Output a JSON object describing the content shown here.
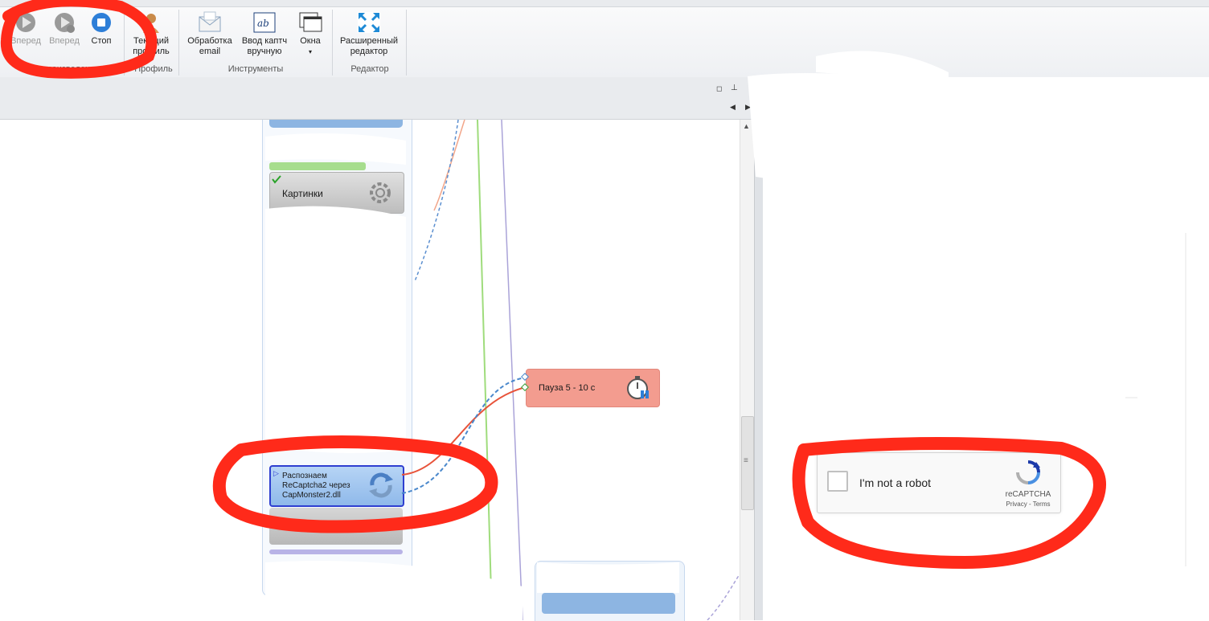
{
  "ribbon": {
    "playback": {
      "forward1_label": "Вперед",
      "forward2_label": "Вперед",
      "stop_label": "Стоп",
      "group_label": "Воспроизведение"
    },
    "profile": {
      "current_label_line1": "Текущий",
      "current_label_line2": "профиль",
      "group_label": "Профиль"
    },
    "tools": {
      "email_line1": "Обработка",
      "email_line2": "email",
      "captcha_line1": "Ввод каптч",
      "captcha_line2": "вручную",
      "windows_label": "Окна",
      "group_label": "Инструменты"
    },
    "editor": {
      "advanced_line1": "Расширенный",
      "advanced_line2": "редактор",
      "group_label": "Редактор"
    }
  },
  "canvas": {
    "nodes": {
      "images": "Картинки",
      "pause": "Пауза 5 - 10 с",
      "recognize_line1": "Распознаем",
      "recognize_line2": "ReCaptcha2 через",
      "recognize_line3": "CapMonster2.dll"
    }
  },
  "recaptcha": {
    "label": "I'm not a robot",
    "brand": "reCAPTCHA",
    "links": "Privacy - Terms"
  },
  "colors": {
    "accent_blue": "#2e7fd8",
    "annotation_red": "#ff2a1a",
    "pause_block": "#f39c8f",
    "selected_block": "#9dc3ef"
  }
}
